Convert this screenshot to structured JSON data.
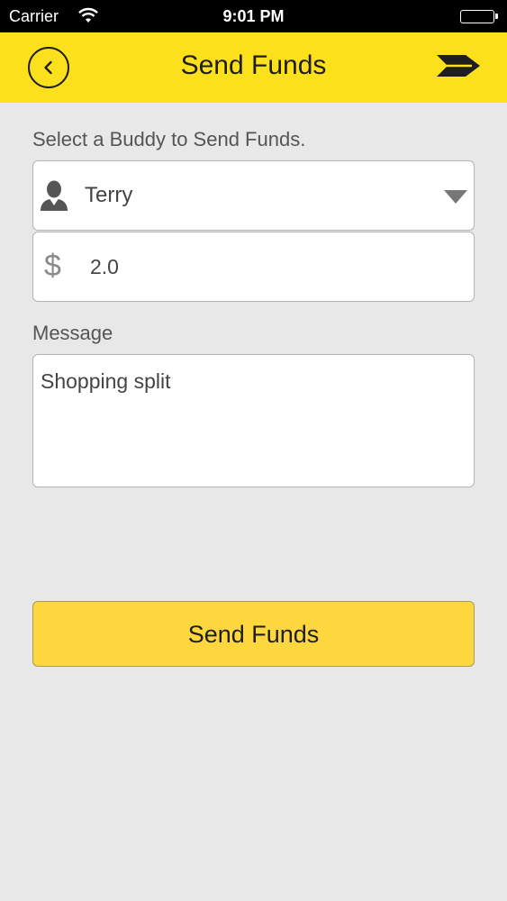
{
  "status_bar": {
    "carrier": "Carrier",
    "time": "9:01 PM",
    "icons": [
      "wifi-icon",
      "battery-icon"
    ]
  },
  "nav": {
    "title": "Send Funds",
    "back_icon": "back-circle-icon",
    "forward_icon": "send-arrow-icon",
    "background_color": "#fde01c"
  },
  "form": {
    "buddy_label": "Select a Buddy to Send Funds.",
    "buddy_value": "Terry",
    "buddy_icon": "user-icon",
    "dropdown_icon": "caret-down-icon",
    "amount_icon": "dollar-icon",
    "amount_symbol": "$",
    "amount_value": "2.0",
    "message_label": "Message",
    "message_value": "Shopping split",
    "submit_label": "Send Funds",
    "submit_color": "#fed73f"
  }
}
